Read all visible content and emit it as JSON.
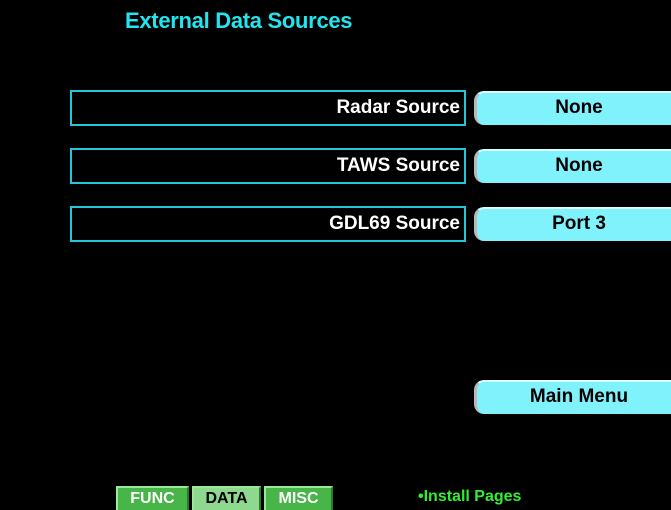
{
  "screen": {
    "title": "External Data Sources"
  },
  "rows": [
    {
      "label": "Radar Source",
      "value": "None"
    },
    {
      "label": "TAWS Source",
      "value": "None"
    },
    {
      "label": "GDL69 Source",
      "value": "Port 3"
    }
  ],
  "main_menu": {
    "label": "Main Menu"
  },
  "tabs": [
    {
      "label": "FUNC",
      "active": false
    },
    {
      "label": "DATA",
      "active": true
    },
    {
      "label": "MISC",
      "active": false
    }
  ],
  "page_group": {
    "label": "•Install Pages"
  },
  "colors": {
    "background": "#000000",
    "title": "#22e5f0",
    "label_border": "#22c8d8",
    "button_fill": "#7ff2fc",
    "tab_inactive": "#47b547",
    "tab_active": "#8fd88f",
    "page_group_text": "#33ee33"
  }
}
